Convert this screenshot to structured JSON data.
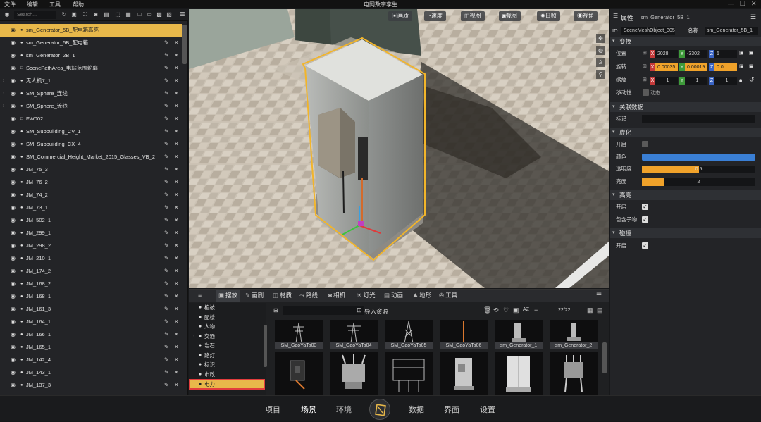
{
  "menu": {
    "file": "文件",
    "edit": "编辑",
    "tools": "工具",
    "help": "帮助"
  },
  "app_title": "电网数字孪生",
  "outliner": {
    "search_placeholder": "Search...",
    "items": [
      {
        "label": "sm_Generator_5B_配电箱高亮",
        "type": "mesh",
        "selected": true,
        "expandable": false
      },
      {
        "label": "sm_Generator_5B_配电箱",
        "type": "mesh",
        "selected": false,
        "expandable": false
      },
      {
        "label": "sm_Generator_2B_1",
        "type": "mesh",
        "selected": false,
        "expandable": false
      },
      {
        "label": "ScenePathArea_电站范围轮廓",
        "type": "area",
        "selected": false,
        "expandable": false
      },
      {
        "label": "无人机7_1",
        "type": "mesh",
        "selected": false,
        "expandable": true
      },
      {
        "label": "SM_Sphere_连线",
        "type": "mesh",
        "selected": false,
        "expandable": true
      },
      {
        "label": "SM_Sphere_流线",
        "type": "mesh",
        "selected": false,
        "expandable": true
      },
      {
        "label": "FW002",
        "type": "area",
        "selected": false,
        "expandable": false
      },
      {
        "label": "SM_Subbuilding_CV_1",
        "type": "mesh",
        "selected": false,
        "expandable": false
      },
      {
        "label": "SM_Subbuilding_CX_4",
        "type": "mesh",
        "selected": false,
        "expandable": false
      },
      {
        "label": "SM_Commercial_Height_Market_2015_Glasses_VB_2",
        "type": "mesh",
        "selected": false,
        "expandable": false
      },
      {
        "label": "JM_75_3",
        "type": "mesh",
        "selected": false,
        "expandable": false
      },
      {
        "label": "JM_76_2",
        "type": "mesh",
        "selected": false,
        "expandable": false
      },
      {
        "label": "JM_74_2",
        "type": "mesh",
        "selected": false,
        "expandable": false
      },
      {
        "label": "JM_73_1",
        "type": "mesh",
        "selected": false,
        "expandable": false
      },
      {
        "label": "JM_502_1",
        "type": "mesh",
        "selected": false,
        "expandable": false
      },
      {
        "label": "JM_299_1",
        "type": "mesh",
        "selected": false,
        "expandable": false
      },
      {
        "label": "JM_298_2",
        "type": "mesh",
        "selected": false,
        "expandable": false
      },
      {
        "label": "JM_210_1",
        "type": "mesh",
        "selected": false,
        "expandable": false
      },
      {
        "label": "JM_174_2",
        "type": "mesh",
        "selected": false,
        "expandable": false
      },
      {
        "label": "JM_168_2",
        "type": "mesh",
        "selected": false,
        "expandable": false
      },
      {
        "label": "JM_168_1",
        "type": "mesh",
        "selected": false,
        "expandable": false
      },
      {
        "label": "JM_161_3",
        "type": "mesh",
        "selected": false,
        "expandable": false
      },
      {
        "label": "JM_164_1",
        "type": "mesh",
        "selected": false,
        "expandable": false
      },
      {
        "label": "JM_166_1",
        "type": "mesh",
        "selected": false,
        "expandable": false
      },
      {
        "label": "JM_165_1",
        "type": "mesh",
        "selected": false,
        "expandable": false
      },
      {
        "label": "JM_142_4",
        "type": "mesh",
        "selected": false,
        "expandable": false
      },
      {
        "label": "JM_143_1",
        "type": "mesh",
        "selected": false,
        "expandable": false
      },
      {
        "label": "JM_137_3",
        "type": "mesh",
        "selected": false,
        "expandable": false
      }
    ]
  },
  "viewport": {
    "buttons": [
      {
        "id": "quality",
        "label": "画质",
        "icon": "image-icon"
      },
      {
        "id": "speed",
        "label": "速度",
        "icon": "gauge-icon"
      },
      {
        "id": "view",
        "label": "视图",
        "icon": "view-icon"
      },
      {
        "id": "screenshot",
        "label": "截图",
        "icon": "camera-icon"
      },
      {
        "id": "sunlight",
        "label": "日照",
        "icon": "sun-icon"
      },
      {
        "id": "viewangle",
        "label": "视角",
        "icon": "eye-icon"
      }
    ],
    "side_tools": [
      "move-icon",
      "globe-icon",
      "person-icon",
      "walk-icon"
    ]
  },
  "properties": {
    "header": "属性",
    "object_name": "sm_Generator_5B_1",
    "id_label": "ID",
    "id_value": "SceneMeshObject_305",
    "name_label": "名称",
    "name_value": "sm_Generator_5B_1",
    "transform": {
      "header": "变换",
      "position_label": "位置",
      "position": {
        "x": "2028",
        "y": "-3302",
        "z": "5"
      },
      "rotation_label": "旋转",
      "rotation": {
        "x": "0.00035",
        "y": "0.00019",
        "z": "0.0"
      },
      "scale_label": "缩放",
      "scale": {
        "x": "1",
        "y": "1",
        "z": "1"
      },
      "mobility_label": "移动性",
      "mobility_value": "动态"
    },
    "related": {
      "header": "关联数据",
      "tag_label": "标记",
      "tag_value": ""
    },
    "virtual": {
      "header": "虚化",
      "enable_label": "开启",
      "enabled": false,
      "color_label": "颜色",
      "color": "#3a7fd5",
      "opacity_label": "透明度",
      "opacity_value": "0.5",
      "opacity_fraction": 0.5,
      "brightness_label": "亮度",
      "brightness_value": "2",
      "brightness_fraction": 0.2
    },
    "highlight": {
      "header": "高亮",
      "enable_label": "开启",
      "enabled": true,
      "children_label": "包含子物...",
      "children": true
    },
    "collision": {
      "header": "碰撞",
      "enable_label": "开启",
      "enabled": true
    }
  },
  "assets": {
    "tabs": [
      {
        "label": "摆放",
        "icon": "place-icon",
        "active": true
      },
      {
        "label": "画刷",
        "icon": "brush-icon",
        "active": false
      },
      {
        "label": "材质",
        "icon": "material-icon",
        "active": false
      },
      {
        "label": "路线",
        "icon": "route-icon",
        "active": false
      },
      {
        "label": "相机",
        "icon": "camera-icon",
        "active": false
      },
      {
        "label": "灯光",
        "icon": "light-icon",
        "active": false
      },
      {
        "label": "动画",
        "icon": "film-icon",
        "active": false
      },
      {
        "label": "地形",
        "icon": "terrain-icon",
        "active": false
      },
      {
        "label": "工具",
        "icon": "wrench-icon",
        "active": false
      }
    ],
    "categories": [
      {
        "label": "植被",
        "expandable": false,
        "selected": false
      },
      {
        "label": "配楼",
        "expandable": false,
        "selected": false
      },
      {
        "label": "人物",
        "expandable": false,
        "selected": false
      },
      {
        "label": "交通",
        "expandable": true,
        "selected": false
      },
      {
        "label": "岩石",
        "expandable": false,
        "selected": false
      },
      {
        "label": "路灯",
        "expandable": false,
        "selected": false
      },
      {
        "label": "标识",
        "expandable": false,
        "selected": false
      },
      {
        "label": "市政",
        "expandable": false,
        "selected": false
      },
      {
        "label": "电力",
        "expandable": false,
        "selected": true
      }
    ],
    "import_label": "导入资源",
    "count": "22/22",
    "row1": [
      "SM_GaoYaTa03",
      "SM_GaoYaTa04",
      "SM_GaoYaTa05",
      "SM_GaoYaTa06",
      "sm_Generator_1",
      "sm_Generator_2"
    ]
  },
  "bottomnav": {
    "items": [
      {
        "label": "项目",
        "active": false
      },
      {
        "label": "场景",
        "active": true
      },
      {
        "label": "环境",
        "active": false
      },
      {
        "label": "数据",
        "active": false
      },
      {
        "label": "界面",
        "active": false
      },
      {
        "label": "设置",
        "active": false
      }
    ]
  }
}
